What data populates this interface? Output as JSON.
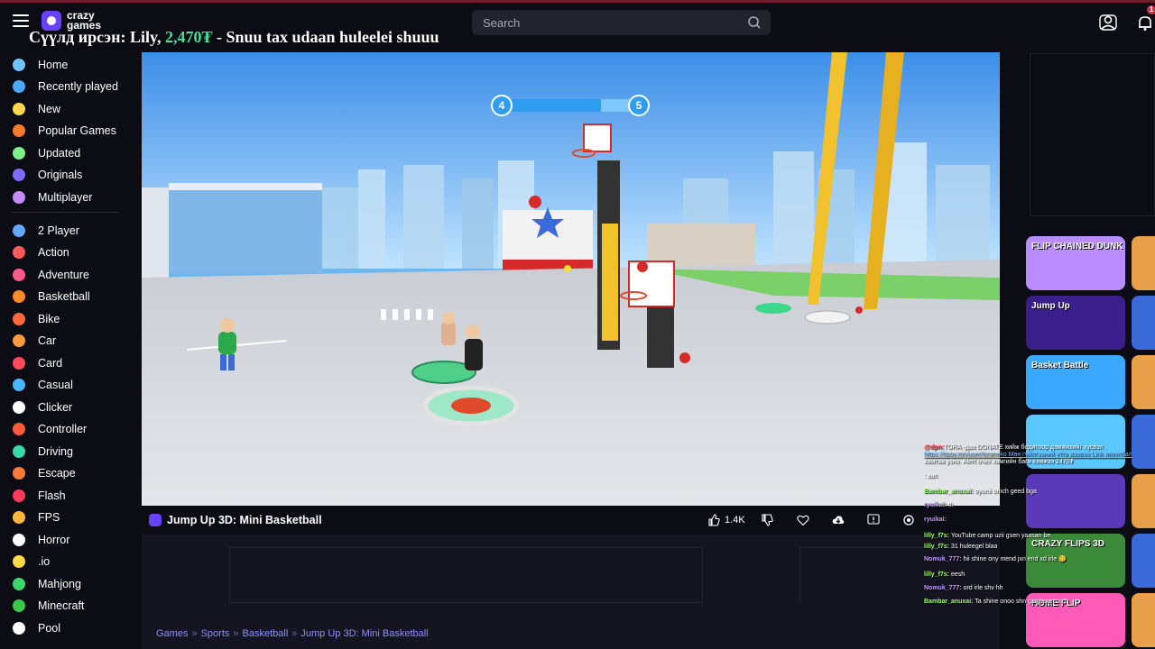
{
  "header": {
    "logo_line1": "crazy",
    "logo_line2": "games",
    "search_placeholder": "Search",
    "notification_count": "1"
  },
  "stream_alert": {
    "prefix": "Сүүлд ирсэн: Lily, ",
    "amount": "2,470₮",
    "suffix": " - Snuu tax udaan huleelei shuuu"
  },
  "sidebar": {
    "items": [
      {
        "label": "Home",
        "icon": "home-icon",
        "color": "#6fc3ff"
      },
      {
        "label": "Recently played",
        "icon": "clock-icon",
        "color": "#4aa8ff"
      },
      {
        "label": "New",
        "icon": "sparkle-icon",
        "color": "#ffd84a"
      },
      {
        "label": "Popular Games",
        "icon": "fire-icon",
        "color": "#ff7a2b"
      },
      {
        "label": "Updated",
        "icon": "refresh-icon",
        "color": "#7cf08a"
      },
      {
        "label": "Originals",
        "icon": "crown-icon",
        "color": "#7f6bff"
      },
      {
        "label": "Multiplayer",
        "icon": "people-icon",
        "color": "#c68bff"
      },
      {
        "label": "2 Player",
        "icon": "two-players-icon",
        "color": "#62a8ff"
      },
      {
        "label": "Action",
        "icon": "sword-icon",
        "color": "#ff5a5a"
      },
      {
        "label": "Adventure",
        "icon": "compass-icon",
        "color": "#ff5a8a"
      },
      {
        "label": "Basketball",
        "icon": "basketball-icon",
        "color": "#ff8a2b"
      },
      {
        "label": "Bike",
        "icon": "bike-icon",
        "color": "#ff6a3a"
      },
      {
        "label": "Car",
        "icon": "car-icon",
        "color": "#ff9a3a"
      },
      {
        "label": "Card",
        "icon": "card-icon",
        "color": "#ff4a5a"
      },
      {
        "label": "Casual",
        "icon": "casual-icon",
        "color": "#4ab8ff"
      },
      {
        "label": "Clicker",
        "icon": "cursor-icon",
        "color": "#ffffff"
      },
      {
        "label": "Controller",
        "icon": "controller-icon",
        "color": "#ff5a3a"
      },
      {
        "label": "Driving",
        "icon": "steering-icon",
        "color": "#3ad8a8"
      },
      {
        "label": "Escape",
        "icon": "door-icon",
        "color": "#ff7a3a"
      },
      {
        "label": "Flash",
        "icon": "flash-icon",
        "color": "#ff3a5a"
      },
      {
        "label": "FPS",
        "icon": "gun-icon",
        "color": "#ffb83a"
      },
      {
        "label": "Horror",
        "icon": "ghost-icon",
        "color": "#ffffff"
      },
      {
        "label": ".io",
        "icon": "io-icon",
        "color": "#ffd84a"
      },
      {
        "label": "Mahjong",
        "icon": "mahjong-icon",
        "color": "#3ad86a"
      },
      {
        "label": "Minecraft",
        "icon": "minecraft-icon",
        "color": "#3ac84a"
      },
      {
        "label": "Pool",
        "icon": "pool-ball-icon",
        "color": "#ffffff"
      }
    ]
  },
  "game": {
    "hud_left": "4",
    "hud_right": "5",
    "hud_progress": 0.75,
    "title": "Jump Up 3D: Mini Basketball",
    "likes": "1.4K"
  },
  "breadcrumb": [
    "Games",
    "Sports",
    "Basketball",
    "Jump Up 3D: Mini Basketball"
  ],
  "thumbnails": [
    {
      "label": "FLIP CHAINED DUNK",
      "bg": "#b98cff"
    },
    {
      "label": "Jump Up",
      "bg": "#3a1e8c"
    },
    {
      "label": "Basket Battle",
      "bg": "#3aa8ff"
    },
    {
      "label": "",
      "bg": "#5ac8ff"
    },
    {
      "label": "",
      "bg": "#5a3ab8"
    },
    {
      "label": "CRAZY FLIPS 3D",
      "bg": "#3a8a3a"
    },
    {
      "label": "HOME FLIP",
      "bg": "#ff5ab8"
    }
  ],
  "chat": [
    {
      "name": "@dpn:",
      "text": "TORA -даа DONATE хийж бодитоор дэмжихийг хүсвэл : ",
      "name_class": "red"
    },
    {
      "name": "",
      "text": "https://tipoy.mn/user/toraneko Мөн гүйлгээний утга дээрээ Link явуулбал",
      "name_class": "link"
    },
    {
      "name": "",
      "text": "хамтаа узнэ. Alert очих хамгийн бага хэмжээ 2470₮",
      "name_class": ""
    },
    {
      "name": "",
      "text": ": aan",
      "name_class": ""
    },
    {
      "name": "Bambar_anuxai:",
      "text": " oyunii omch geed bga",
      "name_class": ""
    },
    {
      "name": "ryuikai:",
      "text": " th",
      "name_class": "purple"
    },
    {
      "name": "ryuikai:",
      "text": "",
      "name_class": "purple"
    },
    {
      "name": "lilly_f7s:",
      "text": " YouTube camp uzii gsen yaasan be",
      "name_class": ""
    },
    {
      "name": "lilly_f7s:",
      "text": " 31 huleegel blaa",
      "name_class": ""
    },
    {
      "name": "Nomuk_777:",
      "text": " hii shine ony mend jxn end xd irle 😊",
      "name_class": "purple"
    },
    {
      "name": "lilly_f7s:",
      "text": " eesh",
      "name_class": ""
    },
    {
      "name": "Nomuk_777:",
      "text": " ord irle shv hh",
      "name_class": "purple"
    },
    {
      "name": "Bambar_anuxai:",
      "text": " Ta shine onoo shn gargasan uu?",
      "name_class": ""
    }
  ]
}
